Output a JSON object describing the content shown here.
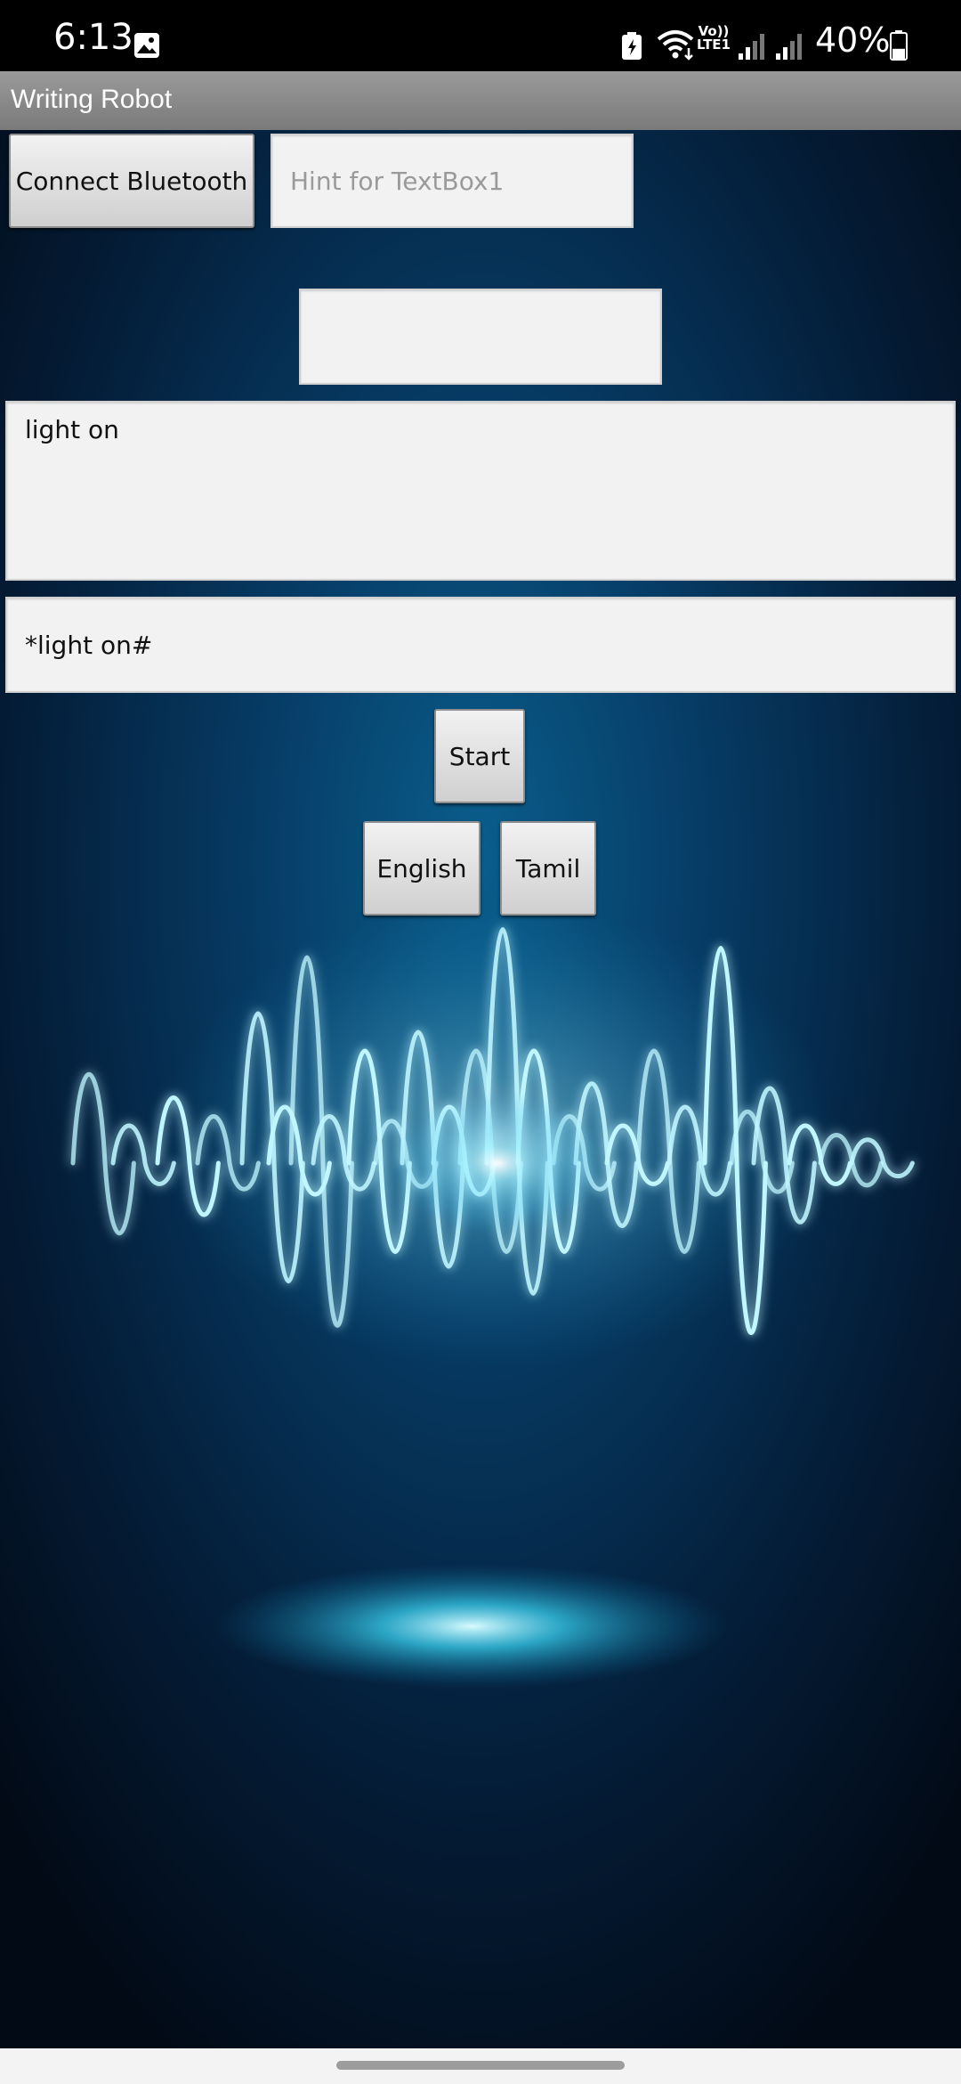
{
  "status_bar": {
    "time": "6:13",
    "network_label": "Vo)) LTE1",
    "battery_percent": "40%",
    "battery_level": 0.4,
    "icons": [
      "gallery-icon",
      "battery-saver-icon",
      "wifi-icon",
      "signal-icon",
      "signal-icon",
      "battery-icon"
    ]
  },
  "app": {
    "title": "Writing Robot"
  },
  "controls": {
    "connect_bluetooth_label": "Connect Bluetooth",
    "textbox1": {
      "value": "",
      "placeholder": "Hint for TextBox1"
    },
    "textbox2": {
      "value": "",
      "placeholder": ""
    },
    "speech_text": "light on",
    "command_text": "*light on#",
    "start_label": "Start",
    "english_label": "English",
    "tamil_label": "Tamil"
  },
  "colors": {
    "background": "#03101f",
    "wave_glow": "#4fd8ff",
    "title_bar": "#8a8a8a"
  }
}
